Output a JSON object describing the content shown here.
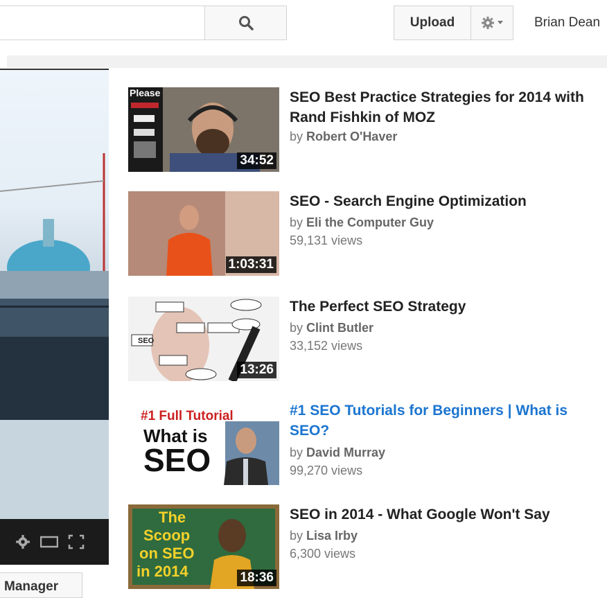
{
  "header": {
    "upload_label": "Upload",
    "user_name": "Brian Dean",
    "icons": {
      "search": "search-icon",
      "settings": "gear-icon",
      "dropdown": "caret-down-icon"
    }
  },
  "sidebar": {
    "manager_label": "Manager"
  },
  "related": [
    {
      "title": "SEO Best Practice Strategies for 2014 with Rand Fishkin of MOZ",
      "by_prefix": "by",
      "author": "Robert O'Haver",
      "views": "",
      "duration": "34:52",
      "thumb_text": "Please"
    },
    {
      "title": "SEO - Search Engine Optimization",
      "by_prefix": "by",
      "author": "Eli the Computer Guy",
      "views": "59,131 views",
      "duration": "1:03:31"
    },
    {
      "title": "The Perfect SEO Strategy",
      "by_prefix": "by",
      "author": "Clint Butler",
      "views": "33,152 views",
      "duration": "13:26",
      "thumb_text": "SEO"
    },
    {
      "title": "#1 SEO Tutorials for Beginners | What is SEO?",
      "by_prefix": "by",
      "author": "David Murray",
      "views": "99,270 views",
      "duration": "",
      "thumb_line1": "#1 Full Tutorial",
      "thumb_line2": "What is",
      "thumb_line3": "SEO"
    },
    {
      "title": "SEO in 2014 - What Google Won't Say",
      "by_prefix": "by",
      "author": "Lisa Irby",
      "views": "6,300 views",
      "duration": "18:36",
      "thumb_line1": "The",
      "thumb_line2": "Scoop",
      "thumb_line3": "on SEO",
      "thumb_line4": "in 2014"
    }
  ]
}
